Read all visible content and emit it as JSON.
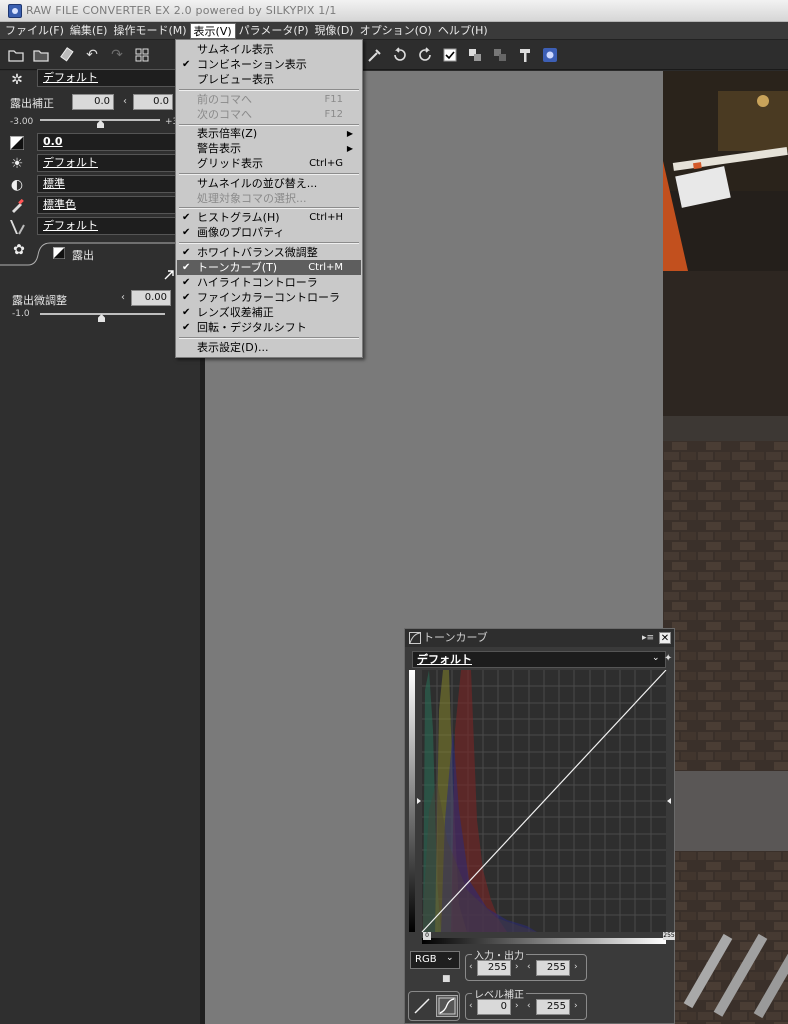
{
  "titlebar": {
    "title": "RAW FILE CONVERTER EX 2.0 powered by SILKYPIX   1/1"
  },
  "menubar": {
    "items": [
      {
        "label": "ファイル(F)"
      },
      {
        "label": "編集(E)"
      },
      {
        "label": "操作モード(M)"
      },
      {
        "label": "表示(V)"
      },
      {
        "label": "パラメータ(P)"
      },
      {
        "label": "現像(D)"
      },
      {
        "label": "オプション(O)"
      },
      {
        "label": "ヘルプ(H)"
      }
    ]
  },
  "view_menu": {
    "items": [
      {
        "label": "サムネイル表示",
        "checked": "",
        "shortcut": ""
      },
      {
        "label": "コンビネーション表示",
        "checked": "✔",
        "shortcut": ""
      },
      {
        "label": "プレビュー表示",
        "checked": "",
        "shortcut": ""
      },
      {
        "label": "前のコマへ",
        "checked": "",
        "shortcut": "F11"
      },
      {
        "label": "次のコマへ",
        "checked": "",
        "shortcut": "F12"
      },
      {
        "label": "表示倍率(Z)",
        "checked": "",
        "shortcut": ""
      },
      {
        "label": "警告表示",
        "checked": "",
        "shortcut": ""
      },
      {
        "label": "グリッド表示",
        "checked": "",
        "shortcut": "Ctrl+G"
      },
      {
        "label": "サムネイルの並び替え...",
        "checked": "",
        "shortcut": ""
      },
      {
        "label": "処理対象コマの選択...",
        "checked": "",
        "shortcut": ""
      },
      {
        "label": "ヒストグラム(H)",
        "checked": "✔",
        "shortcut": "Ctrl+H"
      },
      {
        "label": "画像のプロパティ",
        "checked": "✔",
        "shortcut": ""
      },
      {
        "label": "ホワイトバランス微調整",
        "checked": "✔",
        "shortcut": ""
      },
      {
        "label": "トーンカーブ(T)",
        "checked": "✔",
        "shortcut": "Ctrl+M"
      },
      {
        "label": "ハイライトコントローラ",
        "checked": "✔",
        "shortcut": ""
      },
      {
        "label": "ファインカラーコントローラ",
        "checked": "✔",
        "shortcut": ""
      },
      {
        "label": "レンズ収差補正",
        "checked": "✔",
        "shortcut": ""
      },
      {
        "label": "回転・デジタルシフト",
        "checked": "✔",
        "shortcut": ""
      },
      {
        "label": "表示設定(D)...",
        "checked": "",
        "shortcut": ""
      }
    ],
    "submenu_arrow": "▶"
  },
  "left_panel": {
    "preset_label": "デフォルト",
    "exposure_label": "露出補正",
    "exposure_value": "0.0",
    "exposure_value2": "0.0",
    "exposure_min": "-3.00",
    "exposure_max": "+3",
    "exposure_slider_level": 0.5,
    "exp_field": "0.0",
    "wb_label": "デフォルト",
    "contrast_label": "標準",
    "color_label": "標準色",
    "sharp_label": "デフォルト",
    "tab_label": "露出",
    "fine_label": "露出微調整",
    "fine_value": "0.00",
    "fine_min": "-1.0",
    "fine_slider_level": 0.5
  },
  "tone_curve": {
    "title": "トーンカーブ",
    "preset": "デフォルト",
    "channel": "RGB",
    "io_group": "入力・出力",
    "input": "255",
    "output": "255",
    "level_group": "レベル補正",
    "level_low": "0",
    "level_high": "255",
    "axis_min": "0",
    "axis_max": "255"
  }
}
